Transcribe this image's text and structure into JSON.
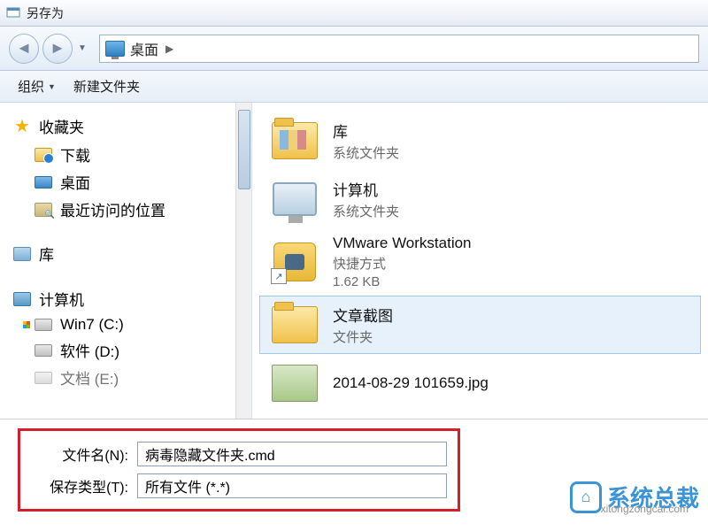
{
  "window": {
    "title": "另存为"
  },
  "address": {
    "location": "桌面"
  },
  "toolbar": {
    "organize": "组织",
    "new_folder": "新建文件夹"
  },
  "sidebar": {
    "favorites": {
      "label": "收藏夹",
      "downloads": "下载",
      "desktop": "桌面",
      "recent": "最近访问的位置"
    },
    "libraries": {
      "label": "库"
    },
    "computer": {
      "label": "计算机",
      "win7": "Win7 (C:)",
      "software": "软件 (D:)",
      "docs": "文档 (E:)"
    }
  },
  "content": {
    "libraries": {
      "name": "库",
      "sub": "系统文件夹"
    },
    "computer": {
      "name": "计算机",
      "sub": "系统文件夹"
    },
    "vmware": {
      "name": "VMware Workstation",
      "sub1": "快捷方式",
      "sub2": "1.62 KB"
    },
    "screenshots": {
      "name": "文章截图",
      "sub": "文件夹"
    },
    "image": {
      "name": "2014-08-29 101659.jpg"
    }
  },
  "save": {
    "filename_label": "文件名(N):",
    "filename_value": "病毒隐藏文件夹.cmd",
    "filetype_label": "保存类型(T):",
    "filetype_value": "所有文件 (*.*)"
  },
  "watermark": {
    "brand": "系统总裁",
    "url": "xitongzongcai.com"
  }
}
